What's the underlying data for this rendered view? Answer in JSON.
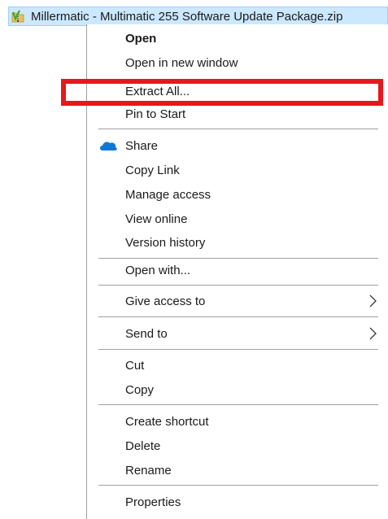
{
  "file": {
    "name": "Millermatic - Multimatic 255 Software Update Package.zip",
    "icon": "zip-folder-icon"
  },
  "menu": {
    "open": "Open",
    "open_new_window": "Open in new window",
    "extract_all": "Extract All...",
    "pin_to_start": "Pin to Start",
    "share": "Share",
    "copy_link": "Copy Link",
    "manage_access": "Manage access",
    "view_online": "View online",
    "version_history": "Version history",
    "open_with": "Open with...",
    "give_access_to": "Give access to",
    "send_to": "Send to",
    "cut": "Cut",
    "copy": "Copy",
    "create_shortcut": "Create shortcut",
    "delete": "Delete",
    "rename": "Rename",
    "properties": "Properties"
  },
  "colors": {
    "highlight": "#e8171f",
    "selection": "#cce8ff",
    "onedrive": "#0f78d4"
  }
}
